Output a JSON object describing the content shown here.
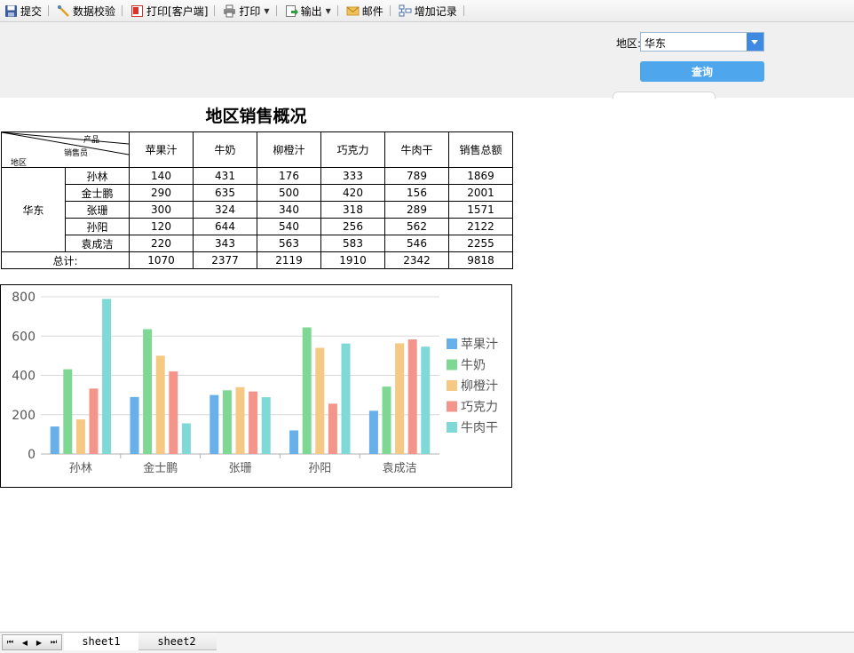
{
  "toolbar": {
    "items": [
      {
        "label": "提交",
        "icon": "save-icon"
      },
      {
        "label": "数据校验",
        "icon": "validate-icon"
      },
      {
        "label": "打印[客户端]",
        "icon": "pdf-print-icon"
      },
      {
        "label": "打印",
        "icon": "printer-icon"
      },
      {
        "label": "输出",
        "icon": "export-icon"
      },
      {
        "label": "邮件",
        "icon": "mail-icon"
      },
      {
        "label": "增加记录",
        "icon": "add-record-icon"
      }
    ]
  },
  "param": {
    "label": "地区:",
    "value": "华东",
    "query_label": "查询"
  },
  "report": {
    "title": "地区销售概况",
    "header_corner": {
      "product": "产品",
      "salesperson": "销售员",
      "region": "地区"
    },
    "columns": [
      "苹果汁",
      "牛奶",
      "柳橙汁",
      "巧克力",
      "牛肉干",
      "销售总额"
    ],
    "region": "华东",
    "rows": [
      {
        "name": "孙林",
        "values": [
          "140",
          "431",
          "176",
          "333",
          "789",
          "1869"
        ]
      },
      {
        "name": "金士鹏",
        "values": [
          "290",
          "635",
          "500",
          "420",
          "156",
          "2001"
        ]
      },
      {
        "name": "张珊",
        "values": [
          "300",
          "324",
          "340",
          "318",
          "289",
          "1571"
        ]
      },
      {
        "name": "孙阳",
        "values": [
          "120",
          "644",
          "540",
          "256",
          "562",
          "2122"
        ]
      },
      {
        "name": "袁成洁",
        "values": [
          "220",
          "343",
          "563",
          "583",
          "546",
          "2255"
        ]
      }
    ],
    "total_label": "总计:",
    "totals": [
      "1070",
      "2377",
      "2119",
      "1910",
      "2342",
      "9818"
    ]
  },
  "chart_data": {
    "type": "bar",
    "categories": [
      "孙林",
      "金士鹏",
      "张珊",
      "孙阳",
      "袁成洁"
    ],
    "series": [
      {
        "name": "苹果汁",
        "color": "#67b0ea",
        "values": [
          140,
          290,
          300,
          120,
          220
        ]
      },
      {
        "name": "牛奶",
        "color": "#7ed893",
        "values": [
          431,
          635,
          324,
          644,
          343
        ]
      },
      {
        "name": "柳橙汁",
        "color": "#f5c883",
        "values": [
          176,
          500,
          340,
          540,
          563
        ]
      },
      {
        "name": "巧克力",
        "color": "#f4958c",
        "values": [
          333,
          420,
          318,
          256,
          583
        ]
      },
      {
        "name": "牛肉干",
        "color": "#7fd9d7",
        "values": [
          789,
          156,
          289,
          562,
          546
        ]
      }
    ],
    "ylim": [
      0,
      800
    ],
    "yticks": [
      0,
      200,
      400,
      600,
      800
    ],
    "grid": true,
    "legend": "right"
  },
  "sheets": [
    "sheet1",
    "sheet2"
  ]
}
